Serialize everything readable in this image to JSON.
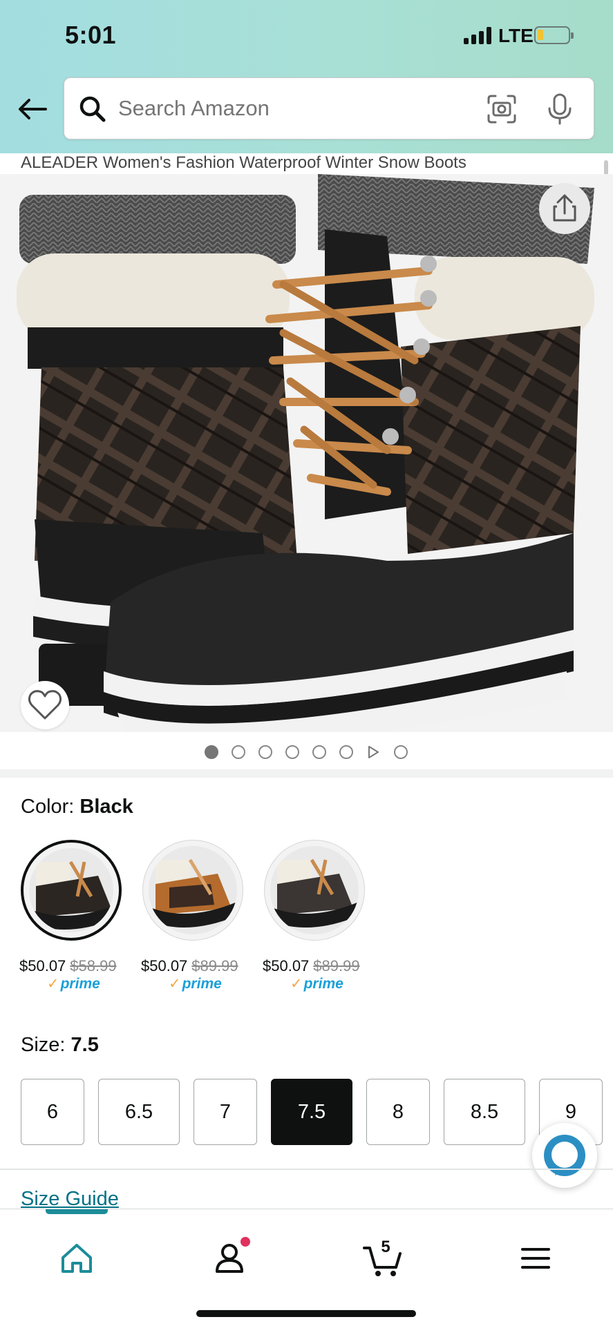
{
  "status_bar": {
    "time": "5:01",
    "network": "LTE"
  },
  "search": {
    "placeholder": "Search Amazon"
  },
  "product": {
    "title": "ALEADER Women's Fashion Waterproof Winter Snow Boots"
  },
  "image_carousel": {
    "dot_count": 7,
    "active_index": 0,
    "has_video": true
  },
  "color": {
    "label": "Color: ",
    "selected": "Black",
    "options": [
      {
        "price": "$50.07",
        "list_price": "$58.99",
        "prime": "prime"
      },
      {
        "price": "$50.07",
        "list_price": "$89.99",
        "prime": "prime"
      },
      {
        "price": "$50.07",
        "list_price": "$89.99",
        "prime": "prime"
      }
    ]
  },
  "size": {
    "label": "Size: ",
    "selected": "7.5",
    "options": [
      "6",
      "6.5",
      "7",
      "7.5",
      "8",
      "8.5",
      "9"
    ]
  },
  "size_guide": "Size Guide",
  "bottom_nav": {
    "cart_count": "5"
  },
  "colors": {
    "accent": "#1c8c99",
    "link": "#007185",
    "prime": "#1aa0d8",
    "badge": "#e0315f"
  }
}
